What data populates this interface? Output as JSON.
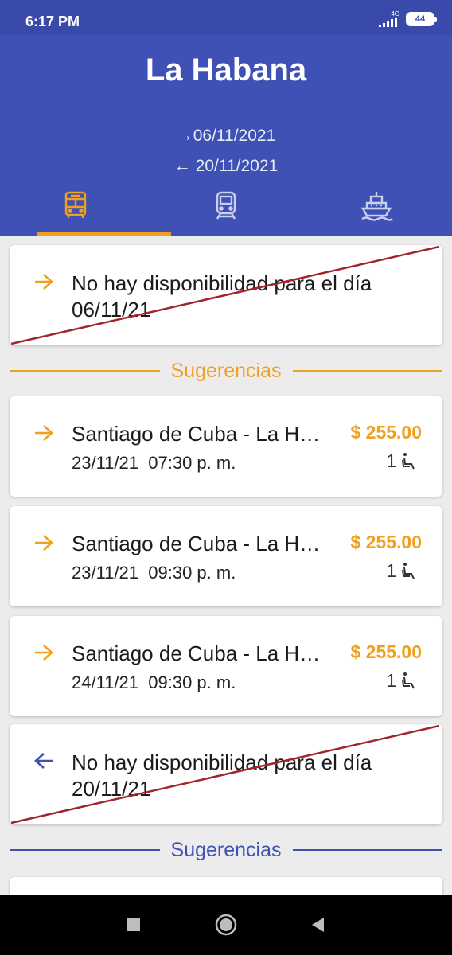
{
  "status_bar": {
    "time": "6:17 PM",
    "network": "4G",
    "battery": "44"
  },
  "header": {
    "title": "La Habana",
    "outbound_date": "06/11/2021",
    "return_date": "20/11/2021",
    "tabs": [
      {
        "name": "bus",
        "icon": "bus-icon",
        "active": true
      },
      {
        "name": "train",
        "icon": "train-icon",
        "active": false
      },
      {
        "name": "ship",
        "icon": "ship-icon",
        "active": false
      }
    ]
  },
  "outbound": {
    "no_availability": "No hay disponibilidad para el día 06/11/21",
    "suggestions_label": "Sugerencias",
    "trips": [
      {
        "route": "Santiago de Cuba - La Habana",
        "date": "23/11/21",
        "time": "07:30 p. m.",
        "price": "$ 255.00",
        "seats": "1"
      },
      {
        "route": "Santiago de Cuba - La Habana",
        "date": "23/11/21",
        "time": "09:30 p. m.",
        "price": "$ 255.00",
        "seats": "1"
      },
      {
        "route": "Santiago de Cuba - La Habana",
        "date": "24/11/21",
        "time": "09:30 p. m.",
        "price": "$ 255.00",
        "seats": "1"
      }
    ]
  },
  "return": {
    "no_availability": "No hay disponibilidad para el día 20/11/21",
    "suggestions_label": "Sugerencias"
  },
  "colors": {
    "primary": "#3f51b5",
    "accent": "#f0a021",
    "strike": "#a0262a",
    "return_accent": "#3f51b5"
  }
}
